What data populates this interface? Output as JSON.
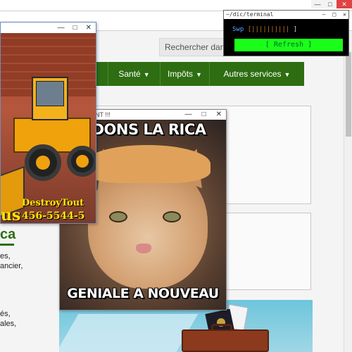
{
  "background_page": {
    "search_placeholder": "Rechercher dans",
    "nav": [
      {
        "label": "Santé"
      },
      {
        "label": "Impôts"
      },
      {
        "label": "Autres services"
      }
    ],
    "left_texts": [
      "es,",
      "ancier,",
      "és,",
      "ales,"
    ],
    "heading_fragment": "ca"
  },
  "popup_bulldozer": {
    "brand": "DestroyTout",
    "phone": "456-5544-5",
    "brand_prefix": "us",
    "controls": {
      "minimize": "—",
      "maximize": "□",
      "close": "✕"
    }
  },
  "popup_meme": {
    "title_fragment": "NT !!!",
    "top_text": "NDONS LA RICA",
    "bottom_text": "GENIALE A NOUVEAU",
    "controls": {
      "minimize": "—",
      "maximize": "□",
      "close": "✕"
    }
  },
  "terminal": {
    "title": "~/dic/terminal",
    "swp_label": "Swp",
    "swp_bars": "[||||||||||",
    "swp_end": "]",
    "refresh_label": "[ Refresh ]",
    "controls": {
      "minimize": "—",
      "maximize": "□",
      "close": "✕"
    }
  },
  "window_controls": {
    "minimize": "—",
    "maximize": "□",
    "close": "✕"
  },
  "colors": {
    "nav_green": "#2e6d12",
    "terminal_refresh": "#1aff1a",
    "close_red": "#e04343"
  }
}
